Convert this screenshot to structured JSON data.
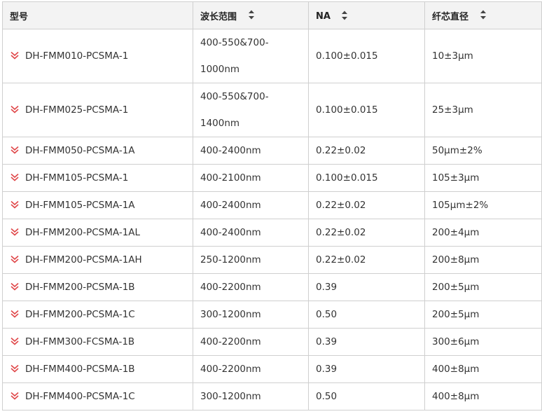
{
  "table": {
    "headers": [
      {
        "label": "型号",
        "sortable": false
      },
      {
        "label": "波长范围",
        "sortable": true
      },
      {
        "label": "NA",
        "sortable": true
      },
      {
        "label": "纤芯直径",
        "sortable": true
      }
    ],
    "rows": [
      {
        "model": "DH-FMM010-PCSMA-1",
        "wavelength": [
          "400-550&700-",
          "1000nm"
        ],
        "na": "0.100±0.015",
        "core": "10±3μm"
      },
      {
        "model": "DH-FMM025-PCSMA-1",
        "wavelength": [
          "400-550&700-",
          "1400nm"
        ],
        "na": "0.100±0.015",
        "core": "25±3μm"
      },
      {
        "model": "DH-FMM050-PCSMA-1A",
        "wavelength": [
          "400-2400nm"
        ],
        "na": "0.22±0.02",
        "core": "50μm±2%"
      },
      {
        "model": "DH-FMM105-PCSMA-1",
        "wavelength": [
          "400-2100nm"
        ],
        "na": "0.100±0.015",
        "core": "105±3μm"
      },
      {
        "model": "DH-FMM105-PCSMA-1A",
        "wavelength": [
          "400-2400nm"
        ],
        "na": "0.22±0.02",
        "core": "105μm±2%"
      },
      {
        "model": "DH-FMM200-PCSMA-1AL",
        "wavelength": [
          "400-2400nm"
        ],
        "na": "0.22±0.02",
        "core": "200±4μm"
      },
      {
        "model": "DH-FMM200-PCSMA-1AH",
        "wavelength": [
          "250-1200nm"
        ],
        "na": "0.22±0.02",
        "core": "200±8μm"
      },
      {
        "model": "DH-FMM200-PCSMA-1B",
        "wavelength": [
          "400-2200nm"
        ],
        "na": "0.39",
        "core": "200±5μm"
      },
      {
        "model": "DH-FMM200-PCSMA-1C",
        "wavelength": [
          "300-1200nm"
        ],
        "na": "0.50",
        "core": "200±5μm"
      },
      {
        "model": "DH-FMM300-FCSMA-1B",
        "wavelength": [
          "400-2200nm"
        ],
        "na": "0.39",
        "core": "300±6μm"
      },
      {
        "model": "DH-FMM400-PCSMA-1B",
        "wavelength": [
          "400-2200nm"
        ],
        "na": "0.39",
        "core": "400±8μm"
      },
      {
        "model": "DH-FMM400-PCSMA-1C",
        "wavelength": [
          "300-1200nm"
        ],
        "na": "0.50",
        "core": "400±8μm"
      }
    ]
  },
  "colors": {
    "expand_icon": "#e0484a",
    "header_bg": "#f3f3f3",
    "border": "#cfcfcf",
    "text": "#333333"
  },
  "icons": {
    "row_expand": "double-chevron-down-icon",
    "sort": "sort-up-down-icon"
  }
}
